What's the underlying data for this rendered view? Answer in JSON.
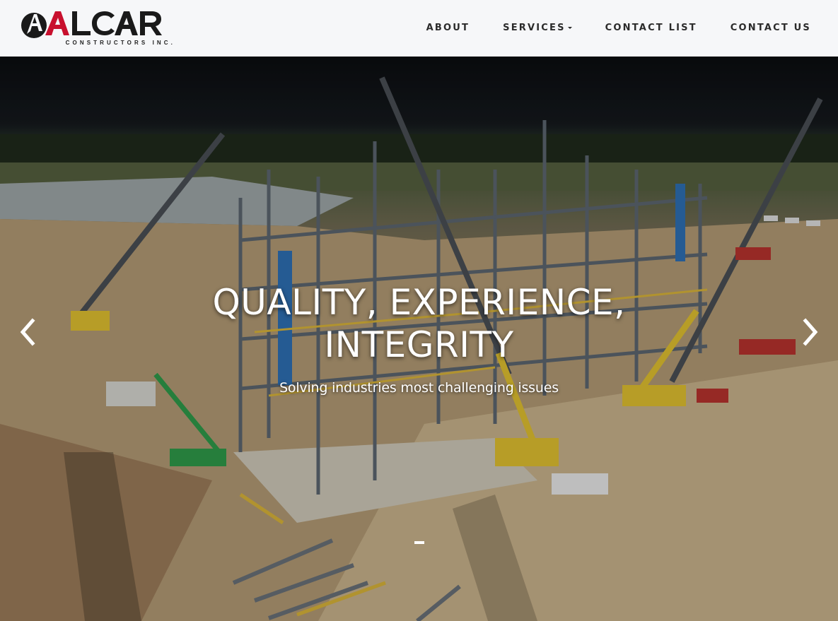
{
  "brand": {
    "logo_text": "ALCAR",
    "logo_subtext": "CONSTRUCTORS INC.",
    "colors": {
      "red": "#c8102e",
      "black": "#1a1a1a"
    }
  },
  "nav": {
    "items": [
      {
        "label": "ABOUT",
        "has_dropdown": false
      },
      {
        "label": "SERVICES",
        "has_dropdown": true
      },
      {
        "label": "CONTACT LIST",
        "has_dropdown": false
      },
      {
        "label": "CONTACT US",
        "has_dropdown": false
      }
    ]
  },
  "hero": {
    "title": "QUALITY, EXPERIENCE, INTEGRITY",
    "subtitle": "Solving industries most challenging issues",
    "prev_icon": "chevron-left-icon",
    "next_icon": "chevron-right-icon",
    "slides_count": 2,
    "active_slide": 1
  }
}
